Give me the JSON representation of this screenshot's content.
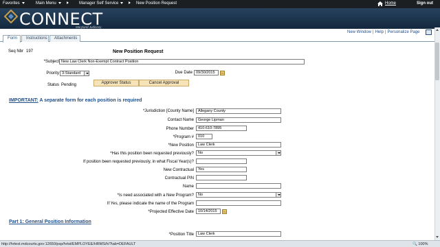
{
  "nav": {
    "favorites": "Favorites",
    "main_menu": "Main Menu",
    "manager_self_service": "Manager Self Service",
    "current_page": "New Position Request",
    "home": "Home",
    "sign_out": "Sign out"
  },
  "brand": {
    "name": "CONNECT",
    "subtitle": "Maryland Judiciary"
  },
  "tabs": [
    {
      "label": "Form"
    },
    {
      "label": "Instructions"
    },
    {
      "label": "Attachments"
    }
  ],
  "page_links": {
    "new_window": "New Window",
    "help": "Help",
    "personalize": "Personalize Page"
  },
  "form": {
    "seq_label": "Seq Nbr",
    "seq_value": "197",
    "title": "New Position Request",
    "subject_label": "*Subject",
    "subject_value": "New Law Clerk Non-Exempt Contract Position",
    "priority_label": "Priority",
    "priority_value": "3-Standard",
    "due_date_label": "Due Date",
    "due_date_value": "09/30/2015",
    "status_label": "Status",
    "status_value": "Pending",
    "approver_status_button": "Approver Status",
    "cancel_approval_button": "Cancel Approval"
  },
  "important": {
    "prefix": "IMPORTANT:",
    "text": " A separate form for each position is required"
  },
  "fields": {
    "jurisdiction_label": "*Jurisdiction [County Name]",
    "jurisdiction_value": "Allegany County",
    "contact_label": "Contact Name",
    "contact_value": "George Lipman",
    "phone_label": "Phone Number",
    "phone_value": "410-610-7895",
    "program_label": "*Program #",
    "program_value": "010",
    "new_position_label": "*New Position",
    "new_position_value": "Law Clerk",
    "requested_prev_label": "*Has this position been requested previously?",
    "requested_prev_value": "No",
    "fiscal_year_label": "If position been requested previously, in what Fiscal Year(s)?",
    "fiscal_year_value": "",
    "new_contractual_label": "New Contractual",
    "new_contractual_value": "Yes",
    "contractual_pin_label": "Contractual PIN",
    "contractual_pin_value": "",
    "name_label": "Name",
    "name_value": "",
    "new_program_label": "*Is need associated with a New Program?",
    "new_program_value": "No",
    "program_name_label": "If Yes, please indicate the name of the Program",
    "program_name_value": "",
    "effective_date_label": "*Projected Effective Date",
    "effective_date_value": "10/14/2015"
  },
  "part1": {
    "heading": "Part 1: General Position Information",
    "position_title_label": "*Position Title",
    "position_title_value": "Law Clerk"
  },
  "statusbar": {
    "url": "http://hrtest.mdcourts.gov:12650/psp/hrtst/EMPLOYEE/HRMS/h/?tab=DEFAULT",
    "zoom": "100%"
  }
}
